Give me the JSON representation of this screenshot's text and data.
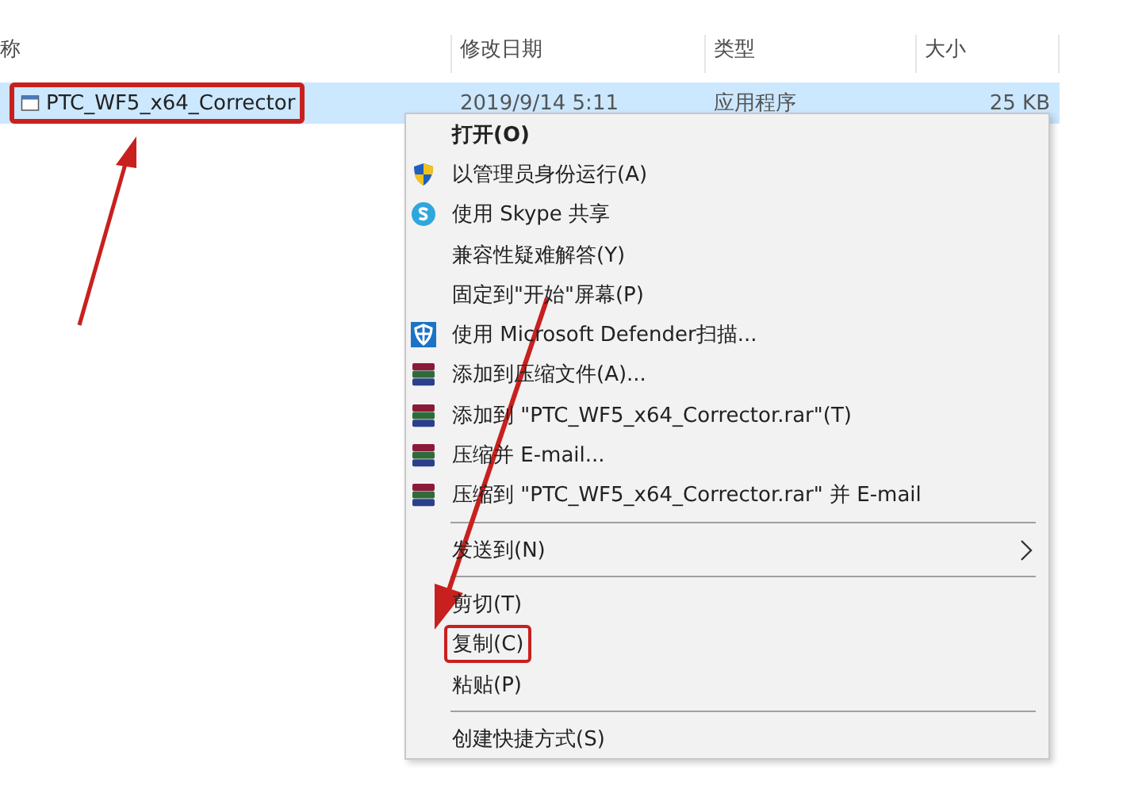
{
  "columns": [
    "称",
    "修改日期",
    "类型",
    "大小"
  ],
  "file": {
    "name": "PTC_WF5_x64_Corrector",
    "modified": "2019/9/14 5:11",
    "type": "应用程序",
    "size": "25 KB",
    "selected": true,
    "highlighted": true
  },
  "menu": [
    {
      "kind": "plain",
      "label": "打开(O)",
      "default": true,
      "highlighted": false
    },
    {
      "kind": "shield",
      "label": "以管理员身份运行(A)",
      "default": false,
      "highlighted": false
    },
    {
      "kind": "skype",
      "label": "使用 Skype 共享",
      "default": false,
      "highlighted": false
    },
    {
      "kind": "plain",
      "label": "兼容性疑难解答(Y)",
      "default": false,
      "highlighted": false
    },
    {
      "kind": "plain",
      "label": "固定到\"开始\"屏幕(P)",
      "default": false,
      "highlighted": false
    },
    {
      "kind": "defender",
      "label": "使用 Microsoft Defender扫描...",
      "default": false,
      "highlighted": false
    },
    {
      "kind": "archive",
      "label": "添加到压缩文件(A)...",
      "default": false,
      "highlighted": false
    },
    {
      "kind": "archive",
      "label": "添加到 \"PTC_WF5_x64_Corrector.rar\"(T)",
      "default": false,
      "highlighted": false
    },
    {
      "kind": "archive",
      "label": "压缩并 E-mail...",
      "default": false,
      "highlighted": false
    },
    {
      "kind": "archive",
      "label": "压缩到 \"PTC_WF5_x64_Corrector.rar\" 并 E-mail",
      "default": false,
      "highlighted": false
    },
    {
      "kind": "separator"
    },
    {
      "kind": "submenu",
      "label": "发送到(N)",
      "default": false,
      "highlighted": false
    },
    {
      "kind": "separator"
    },
    {
      "kind": "plain",
      "label": "剪切(T)",
      "default": false,
      "highlighted": false
    },
    {
      "kind": "plain",
      "label": "复制(C)",
      "default": false,
      "highlighted": true
    },
    {
      "kind": "plain",
      "label": "粘贴(P)",
      "default": false,
      "highlighted": false
    },
    {
      "kind": "separator"
    },
    {
      "kind": "plain",
      "label": "创建快捷方式(S)",
      "default": false,
      "highlighted": false
    }
  ]
}
